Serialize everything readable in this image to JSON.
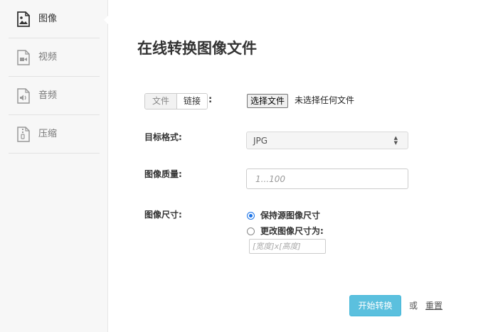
{
  "sidebar": {
    "items": [
      {
        "label": "图像",
        "icon": "image-icon",
        "active": true
      },
      {
        "label": "视频",
        "icon": "video-icon",
        "active": false
      },
      {
        "label": "音频",
        "icon": "audio-icon",
        "active": false
      },
      {
        "label": "压缩",
        "icon": "archive-icon",
        "active": false
      }
    ]
  },
  "main": {
    "title": "在线转换图像文件",
    "source": {
      "tab_file": "文件",
      "tab_link": "链接",
      "colon": ":",
      "choose_button": "选择文件",
      "file_status": "未选择任何文件"
    },
    "format": {
      "label": "目标格式:",
      "selected": "JPG"
    },
    "quality": {
      "label": "图像质量:",
      "placeholder": "1...100"
    },
    "size": {
      "label": "图像尺寸:",
      "option_keep": "保持源图像尺寸",
      "option_change": "更改图像尺寸为:",
      "input_placeholder": "[宽度]x[高度]"
    },
    "actions": {
      "start": "开始转换",
      "or": "或",
      "reset": "重置"
    }
  },
  "colors": {
    "accent": "#5bc0de",
    "radio": "#1a73e8",
    "sidebar_bg": "#f7f7f7"
  }
}
